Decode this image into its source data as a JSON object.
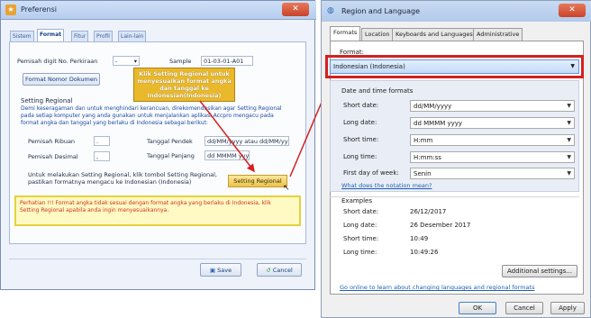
{
  "left_dialog": {
    "title": "Preferensi",
    "tabs": [
      "Sistem",
      "Format",
      "Fitur",
      "Profil",
      "Lain-lain"
    ],
    "pemisah_digit_label": "Pemisah digit No. Perkiraan",
    "pemisah_digit_value": "-",
    "sample_label": "Sample",
    "sample_value": "01-03-01-A01",
    "format_nomor_button": "Format Nomor Dokumen",
    "callout_lines": [
      "Klik Setting Regional untuk",
      "menyesuaikan format angka",
      "dan tanggal ke",
      "Indonesian(Indonesia)"
    ],
    "setting_regional_heading": "Setting Regional",
    "description_lines": [
      "Demi keseragaman dan untuk menghindari kerancuan, direkomendasikan agar Setting Regional",
      "pada setiap komputer yang anda gunakan untuk menjalankan aplikasi Accpro mengacu pada",
      "format angka dan tanggal yang berlaku di Indonesia sebagai berikut:"
    ],
    "pemisah_ribuan_label": "Pemisah Ribuan",
    "pemisah_ribuan_value": ".",
    "pemisah_desimal_label": "Pemisah Desimal",
    "pemisah_desimal_value": ",",
    "tanggal_pendek_label": "Tanggal Pendek",
    "tanggal_pendek_value": "dd/MM/yyyy atau dd/MM/yy",
    "tanggal_panjang_label": "Tanggal Panjang",
    "tanggal_panjang_value": "dd MMMM yyyy",
    "instruction_lines": [
      "Untuk melakukan Setting Regional, klik tombol Setting Regional,",
      "pastikan formatnya mengacu ke Indonesian (Indonesia)"
    ],
    "setting_regional_button": "Setting Regional",
    "warning_lines": [
      "Perhatian !!!   Format angka tidak sesuai dengan format angka yang berlaku di Indonesia, klik",
      "Setting Regional apabila anda ingin menyesuaikannya."
    ],
    "save_button": "Save",
    "cancel_button": "Cancel",
    "accent_color": "#e9b92b",
    "warning_color": "#d2341a"
  },
  "right_dialog": {
    "title": "Region and Language",
    "tabs": [
      "Formats",
      "Location",
      "Keyboards and Languages",
      "Administrative"
    ],
    "format_label": "Format:",
    "format_value": "Indonesian (Indonesia)",
    "dt_heading": "Date and time formats",
    "rows": [
      {
        "label": "Short date:",
        "value": "dd/MM/yyyy"
      },
      {
        "label": "Long date:",
        "value": "dd MMMM yyyy"
      },
      {
        "label": "Short time:",
        "value": "H:mm"
      },
      {
        "label": "Long time:",
        "value": "H:mm:ss"
      },
      {
        "label": "First day of week:",
        "value": "Senin"
      }
    ],
    "notation_link": "What does the notation mean?",
    "examples_heading": "Examples",
    "examples": [
      {
        "label": "Short date:",
        "value": "26/12/2017"
      },
      {
        "label": "Long date:",
        "value": "26 Desember 2017"
      },
      {
        "label": "Short time:",
        "value": "10:49"
      },
      {
        "label": "Long time:",
        "value": "10:49:26"
      }
    ],
    "additional_button": "Additional settings...",
    "online_link": "Go online to learn about changing languages and regional formats",
    "ok_button": "OK",
    "cancel_button": "Cancel",
    "apply_button": "Apply",
    "highlight_color": "#d42020"
  }
}
